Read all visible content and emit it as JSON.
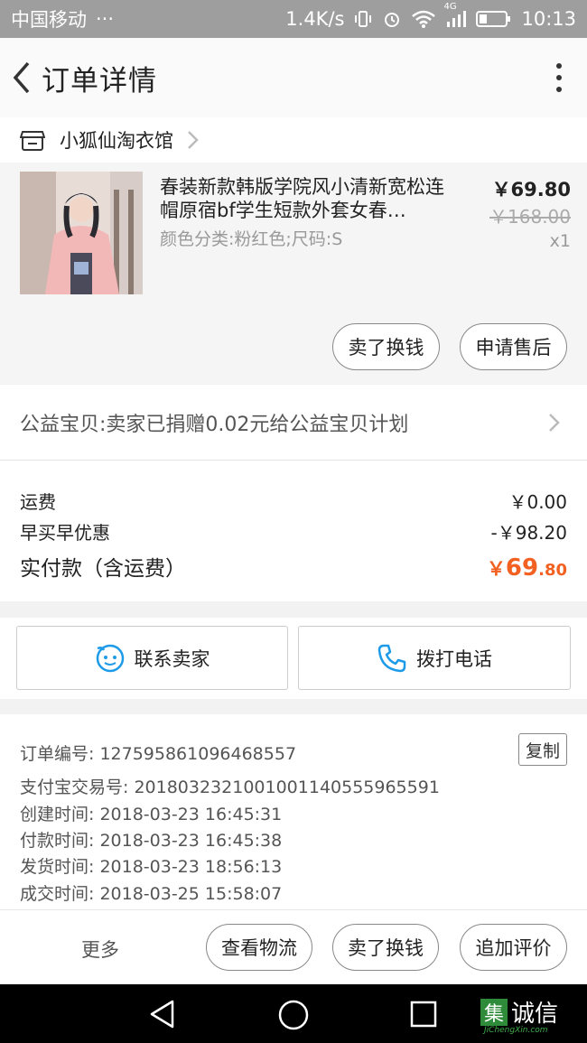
{
  "status_bar": {
    "carrier": "中国移动",
    "dots": "···",
    "speed": "1.4K/s",
    "network": "4G",
    "time": "10:13"
  },
  "nav": {
    "title": "订单详情"
  },
  "shop": {
    "name": "小狐仙淘衣馆"
  },
  "product": {
    "name": "春装新款韩版学院风小清新宽松连帽原宿bf学生短款外套女春…",
    "sku": "颜色分类:粉红色;尺码:S",
    "price": "￥69.80",
    "original_price": "￥168.00",
    "quantity": "x1",
    "actions": [
      "卖了换钱",
      "申请售后"
    ]
  },
  "charity": {
    "text": "公益宝贝:卖家已捐赠0.02元给公益宝贝计划"
  },
  "summary": {
    "shipping_label": "运费",
    "shipping_value": "￥0.00",
    "discount_label": "早买早优惠",
    "discount_value": "-￥98.20",
    "total_label": "实付款（含运费）",
    "total_currency": "￥",
    "total_int": "69",
    "total_dec": ".80"
  },
  "contact": {
    "seller_label": "联系卖家",
    "call_label": "拨打电话"
  },
  "order_info": {
    "lines": [
      "订单编号: 127595861096468557",
      "支付宝交易号: 2018032321001001140555965591",
      "创建时间: 2018-03-23 16:45:31",
      "付款时间: 2018-03-23 16:45:38",
      "发货时间: 2018-03-23 18:56:13",
      "成交时间: 2018-03-25 15:58:07"
    ],
    "copy_label": "复制"
  },
  "action_bar": {
    "more_label": "更多",
    "buttons": [
      "查看物流",
      "卖了换钱",
      "追加评价"
    ]
  },
  "watermark": {
    "glyph": "集",
    "text": "诚信",
    "sub": "JiChengXin.com"
  },
  "colors": {
    "accent_orange": "#f26122",
    "contact_blue": "#1e9be8"
  }
}
